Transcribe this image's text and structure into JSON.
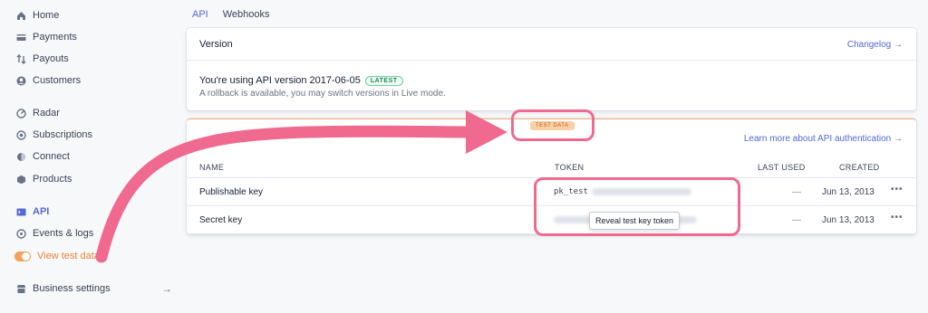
{
  "sidebar": {
    "items": [
      {
        "label": "Home",
        "icon": "home-icon"
      },
      {
        "label": "Payments",
        "icon": "payments-icon"
      },
      {
        "label": "Payouts",
        "icon": "payouts-icon"
      },
      {
        "label": "Customers",
        "icon": "customers-icon"
      },
      {
        "label": "Radar",
        "icon": "radar-icon"
      },
      {
        "label": "Subscriptions",
        "icon": "subscriptions-icon"
      },
      {
        "label": "Connect",
        "icon": "connect-icon"
      },
      {
        "label": "Products",
        "icon": "products-icon"
      },
      {
        "label": "API",
        "icon": "api-icon"
      },
      {
        "label": "Events & logs",
        "icon": "events-icon"
      },
      {
        "label": "View test data",
        "icon": "toggle-icon"
      },
      {
        "label": "Business settings",
        "icon": "business-icon"
      }
    ],
    "arrow": "→"
  },
  "tabs": [
    {
      "label": "API"
    },
    {
      "label": "Webhooks"
    }
  ],
  "version_card": {
    "title": "Version",
    "changelog": "Changelog →",
    "version_text": "You're using API version 2017-06-05",
    "badge": "LATEST",
    "rollback": "A rollback is available, you may switch versions in Live mode."
  },
  "keys_card": {
    "test_badge": "TEST DATA",
    "learn_link": "Learn more about API authentication →",
    "columns": [
      "NAME",
      "TOKEN",
      "LAST USED",
      "CREATED"
    ],
    "rows": [
      {
        "name": "Publishable key",
        "token_prefix": "pk_test",
        "last_used": "—",
        "created": "Jun 13, 2013",
        "more": "•••"
      },
      {
        "name": "Secret key",
        "token_prefix": "",
        "last_used": "—",
        "created": "Jun 13, 2013",
        "more": "•••"
      }
    ],
    "tooltip": "Reveal test key token"
  },
  "colors": {
    "accent": "#5469d4",
    "test_orange": "#e5843b",
    "annotation_pink": "#f06a8f"
  }
}
